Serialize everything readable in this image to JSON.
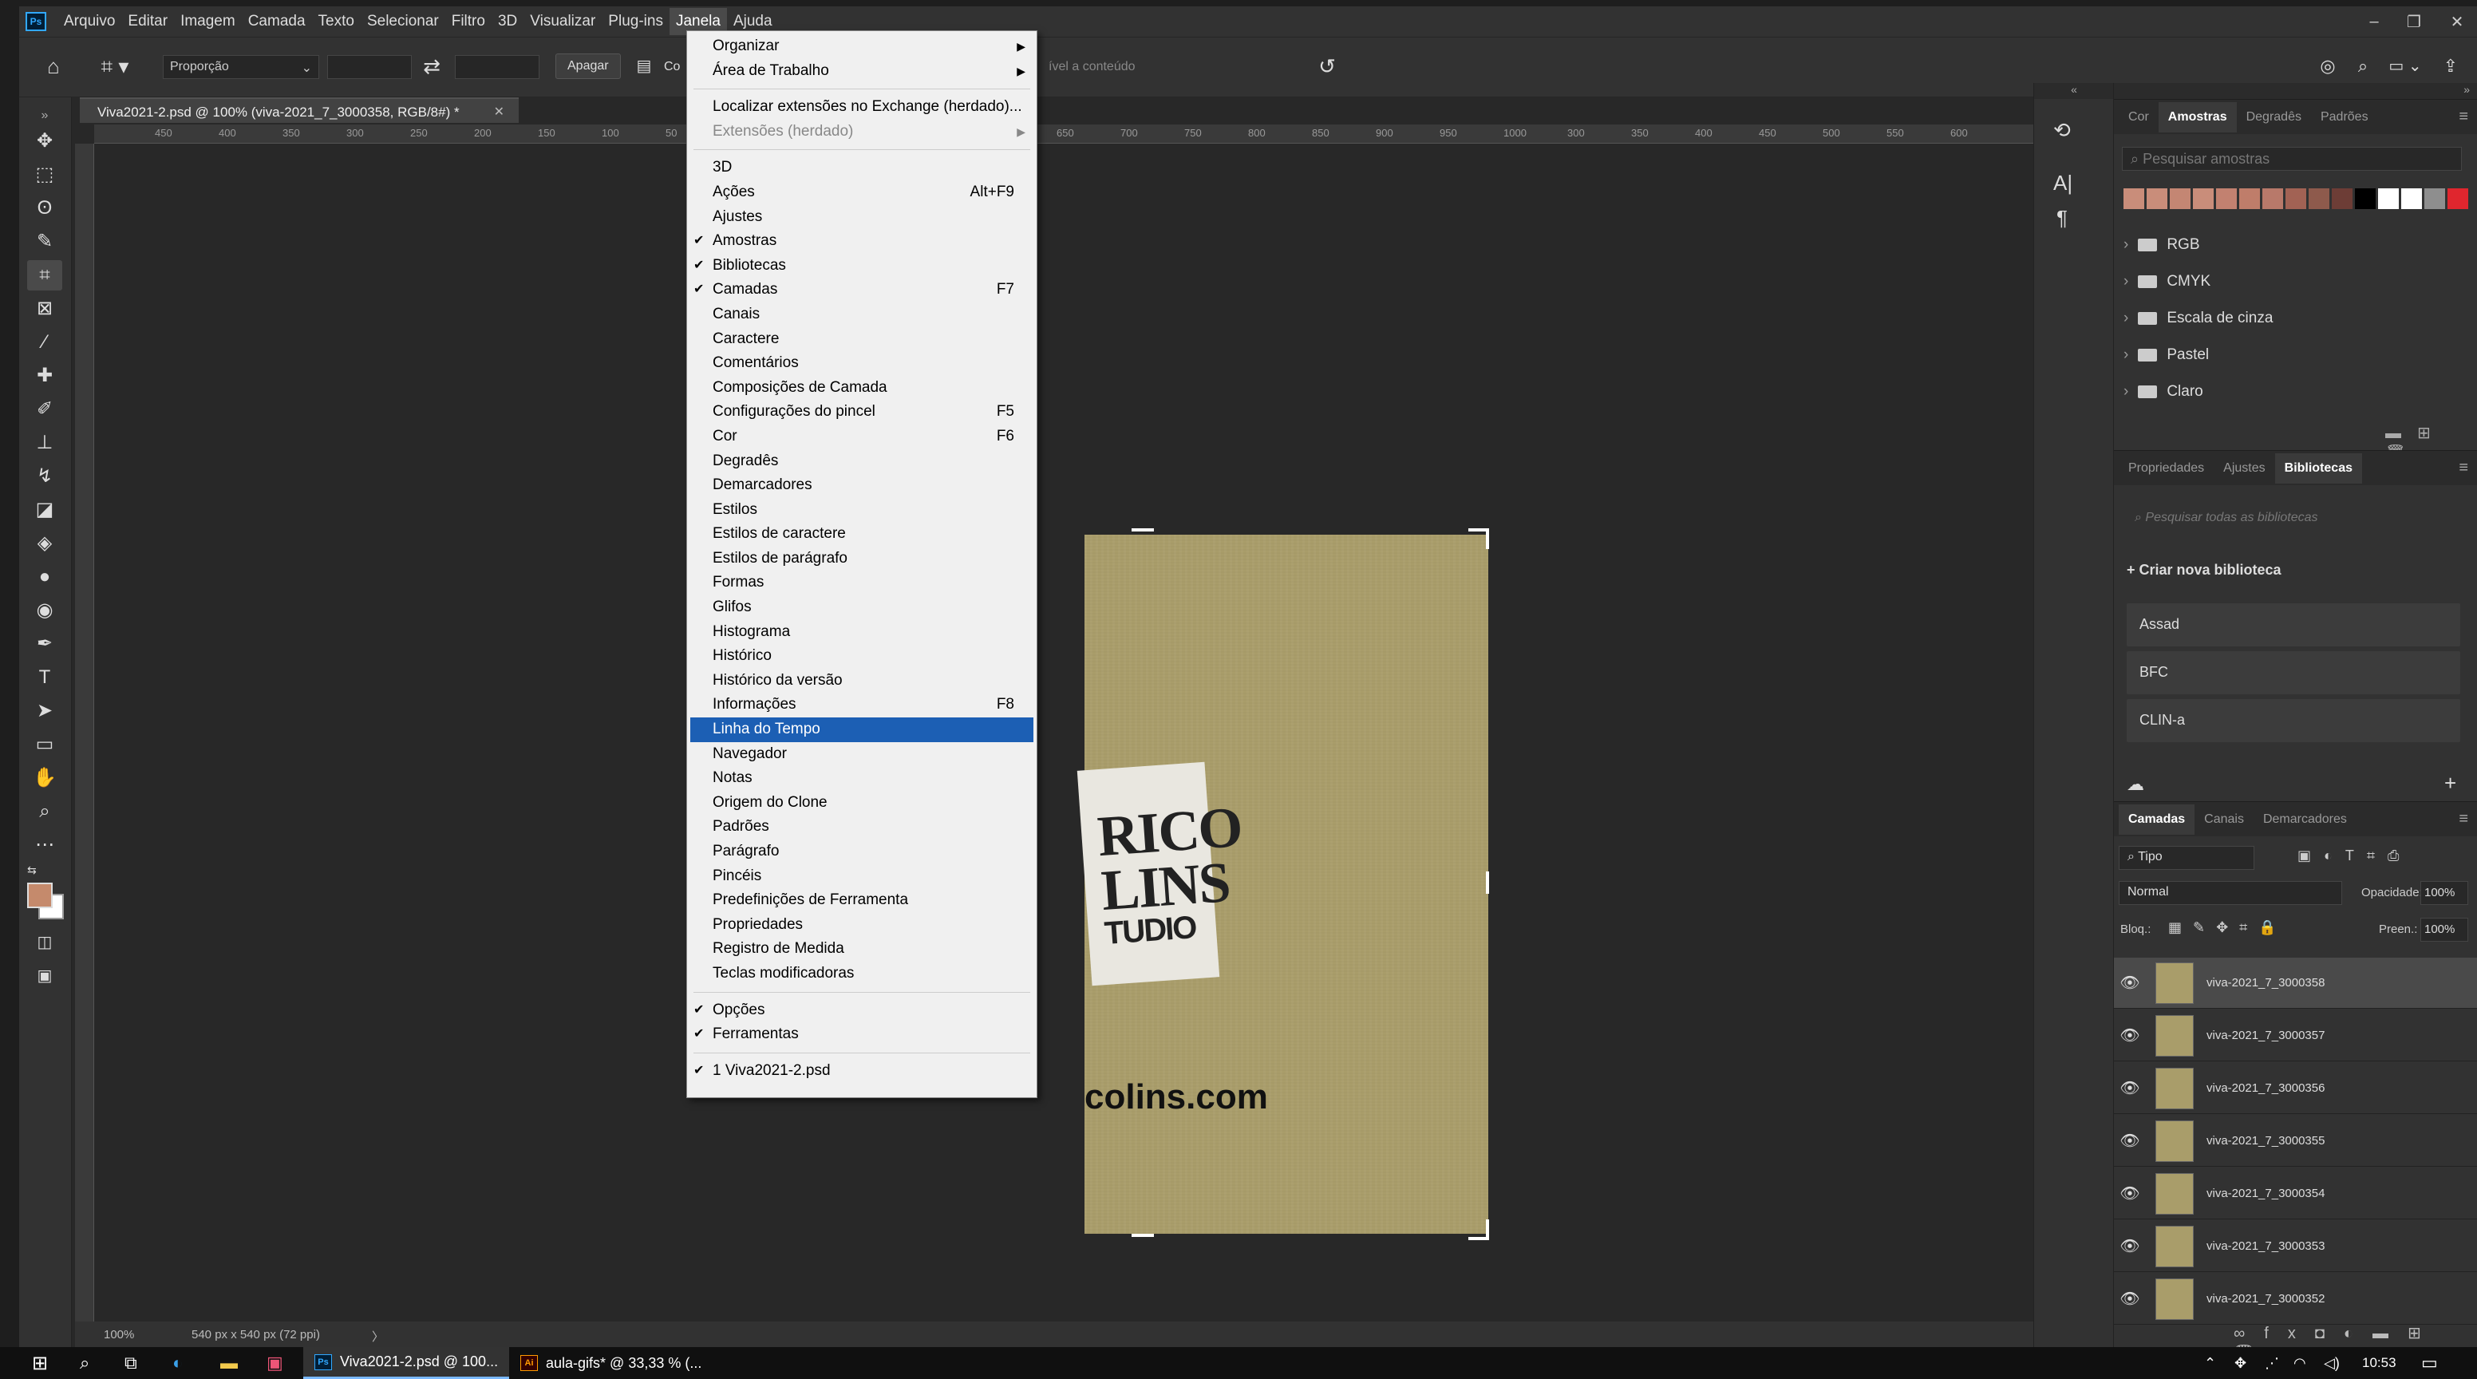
{
  "menubar": {
    "items": [
      "Arquivo",
      "Editar",
      "Imagem",
      "Camada",
      "Texto",
      "Selecionar",
      "Filtro",
      "3D",
      "Visualizar",
      "Plug-ins",
      "Janela",
      "Ajuda"
    ],
    "active": "Janela"
  },
  "options": {
    "ratio": "Proporção",
    "clear": "Apagar",
    "content_aware_partial": "Co",
    "content_aware_tail": "ível a conteúdo"
  },
  "document": {
    "tab_title": "Viva2021-2.psd @ 100% (viva-2021_7_3000358, RGB/8#) *",
    "sticker_lines": [
      "RICO",
      "LINS"
    ],
    "sticker_sub": "TUDIO",
    "site_text": "colins.com",
    "ruler_labels": [
      "450",
      "400",
      "350",
      "300",
      "250",
      "200",
      "150",
      "100",
      "50",
      "650",
      "700",
      "750",
      "800",
      "850",
      "900",
      "950",
      "1000",
      "300",
      "350",
      "400",
      "450",
      "500",
      "550",
      "600"
    ]
  },
  "status": {
    "zoom": "100%",
    "size": "540 px x 540 px (72 ppi)",
    "arrow": "〉"
  },
  "janela_menu": [
    {
      "label": "Organizar",
      "arrow": true
    },
    {
      "label": "Área de Trabalho",
      "arrow": true
    },
    {
      "sep": true
    },
    {
      "label": "Localizar extensões no Exchange (herdado)..."
    },
    {
      "label": "Extensões (herdado)",
      "arrow": true,
      "disabled": true
    },
    {
      "sep": true
    },
    {
      "label": "3D"
    },
    {
      "label": "Ações",
      "shortcut": "Alt+F9"
    },
    {
      "label": "Ajustes"
    },
    {
      "label": "Amostras",
      "checked": true
    },
    {
      "label": "Bibliotecas",
      "checked": true
    },
    {
      "label": "Camadas",
      "checked": true,
      "shortcut": "F7"
    },
    {
      "label": "Canais"
    },
    {
      "label": "Caractere"
    },
    {
      "label": "Comentários"
    },
    {
      "label": "Composições de Camada"
    },
    {
      "label": "Configurações do pincel",
      "shortcut": "F5"
    },
    {
      "label": "Cor",
      "shortcut": "F6"
    },
    {
      "label": "Degradês"
    },
    {
      "label": "Demarcadores"
    },
    {
      "label": "Estilos"
    },
    {
      "label": "Estilos de caractere"
    },
    {
      "label": "Estilos de parágrafo"
    },
    {
      "label": "Formas"
    },
    {
      "label": "Glifos"
    },
    {
      "label": "Histograma"
    },
    {
      "label": "Histórico"
    },
    {
      "label": "Histórico da versão"
    },
    {
      "label": "Informações",
      "shortcut": "F8"
    },
    {
      "label": "Linha do Tempo",
      "highlighted": true
    },
    {
      "label": "Navegador"
    },
    {
      "label": "Notas"
    },
    {
      "label": "Origem do Clone"
    },
    {
      "label": "Padrões"
    },
    {
      "label": "Parágrafo"
    },
    {
      "label": "Pincéis"
    },
    {
      "label": "Predefinições de Ferramenta"
    },
    {
      "label": "Propriedades"
    },
    {
      "label": "Registro de Medida"
    },
    {
      "label": "Teclas modificadoras"
    },
    {
      "sep": true
    },
    {
      "label": "Opções",
      "checked": true
    },
    {
      "label": "Ferramentas",
      "checked": true
    },
    {
      "sep": true
    },
    {
      "label": "1 Viva2021-2.psd",
      "checked": true
    }
  ],
  "swatches_panel": {
    "tabs": [
      "Cor",
      "Amostras",
      "Degradês",
      "Padrões"
    ],
    "active": "Amostras",
    "search_placeholder": "Pesquisar amostras",
    "colors": [
      "#c98d7a",
      "#c98d7a",
      "#c48673",
      "#c98d7a",
      "#c28170",
      "#bf7d6a",
      "#b8796a",
      "#a26254",
      "#8e5a4c",
      "#6d3d36",
      "#000000",
      "#ffffff",
      "#ffffff",
      "#8e8e8e",
      "#e0262e"
    ],
    "folders": [
      "RGB",
      "CMYK",
      "Escala de cinza",
      "Pastel",
      "Claro"
    ]
  },
  "libraries_panel": {
    "tabs": [
      "Propriedades",
      "Ajustes",
      "Bibliotecas"
    ],
    "active": "Bibliotecas",
    "search_placeholder": "Pesquisar todas as bibliotecas",
    "create": "Criar nova biblioteca",
    "libraries": [
      "Assad",
      "BFC",
      "CLIN-a"
    ]
  },
  "layers_panel": {
    "tabs": [
      "Camadas",
      "Canais",
      "Demarcadores"
    ],
    "active": "Camadas",
    "filter": "Tipo",
    "blend": "Normal",
    "opacity_label": "Opacidade:",
    "opacity": "100%",
    "lock_label": "Bloq.:",
    "fill_label": "Preen.:",
    "fill": "100%",
    "layers": [
      "viva-2021_7_3000358",
      "viva-2021_7_3000357",
      "viva-2021_7_3000356",
      "viva-2021_7_3000355",
      "viva-2021_7_3000354",
      "viva-2021_7_3000353",
      "viva-2021_7_3000352"
    ]
  },
  "taskbar": {
    "apps": [
      "Viva2021-2.psd @ 100...",
      "aula-gifs* @ 33,33 % (..."
    ],
    "time": "10:53"
  }
}
